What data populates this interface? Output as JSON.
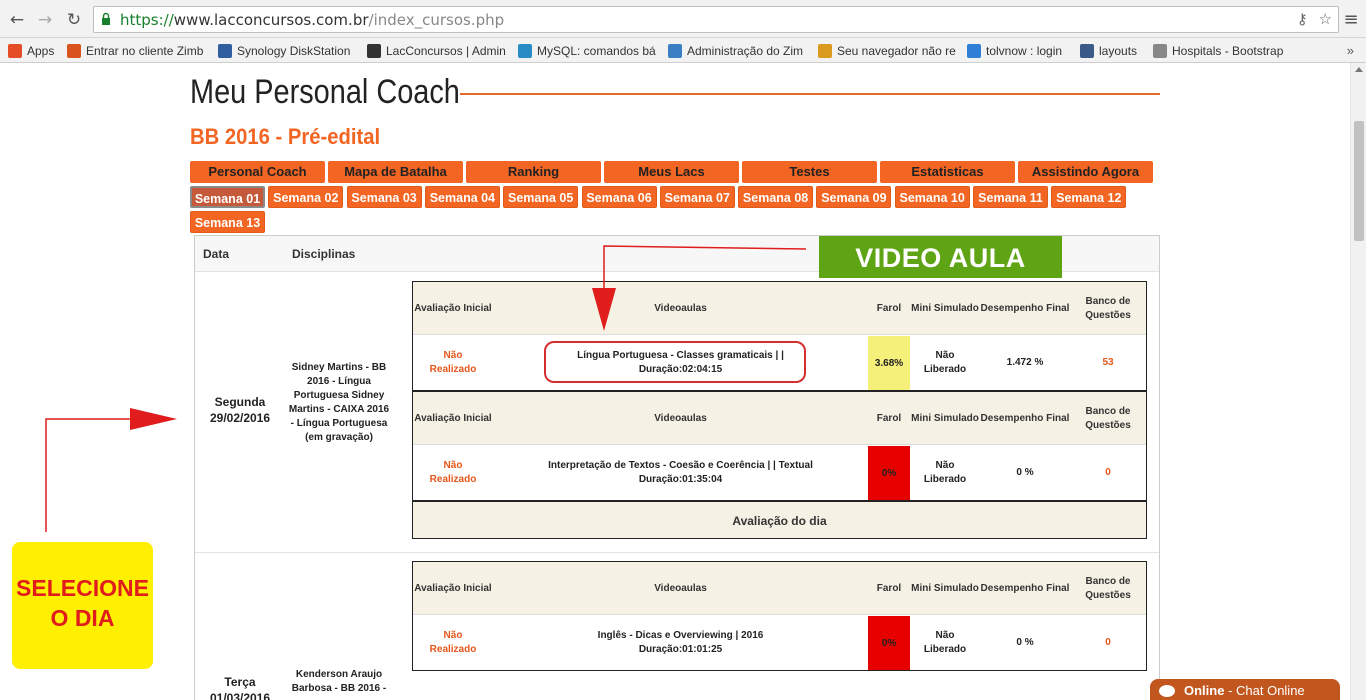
{
  "browser": {
    "url_scheme": "https://",
    "url_host": "www.lacconcursos.com.br",
    "url_path": "/index_cursos.php",
    "back_icon": "arrow-left-icon",
    "forward_icon": "arrow-right-icon",
    "reload_icon": "reload-icon",
    "key_icon": "key-icon",
    "star_icon": "star-icon",
    "bookmarks": [
      {
        "label": "Apps",
        "icon": "apps-grid-icon",
        "color": "#e44d26"
      },
      {
        "label": "Entrar no cliente Zimb",
        "icon": "zimbra-icon",
        "color": "#d9531e"
      },
      {
        "label": "Synology DiskStation",
        "icon": "dsm-icon",
        "color": "#2f5f9e"
      },
      {
        "label": "LacConcursos | Admin",
        "icon": "lac-icon",
        "color": "#333333"
      },
      {
        "label": "MySQL: comandos bá",
        "icon": "mysql-icon",
        "color": "#2a8cc4"
      },
      {
        "label": "Administração do Zim",
        "icon": "zimbra-z-icon",
        "color": "#3a7fc4"
      },
      {
        "label": "Seu navegador não re",
        "icon": "tt-icon",
        "color": "#d99a1e"
      },
      {
        "label": "tolvnow : login",
        "icon": "chat-bubble-icon",
        "color": "#2f7fd6"
      },
      {
        "label": "layouts",
        "icon": "w3-icon",
        "color": "#3b5a8a"
      },
      {
        "label": "Hospitals - Bootstrap",
        "icon": "page-icon",
        "color": "#888888"
      }
    ],
    "bookmarks_more": "»"
  },
  "page": {
    "title": "Meu Personal Coach",
    "course": "BB 2016 - Pré-edital",
    "tabs": [
      "Personal Coach",
      "Mapa de Batalha",
      "Ranking",
      "Meus Lacs",
      "Testes",
      "Estatisticas",
      "Assistindo Agora"
    ],
    "weeks": [
      "Semana 01",
      "Semana 02",
      "Semana 03",
      "Semana 04",
      "Semana 05",
      "Semana 06",
      "Semana 07",
      "Semana 08",
      "Semana 09",
      "Semana 10",
      "Semana 11",
      "Semana 12",
      "Semana 13"
    ],
    "active_week": "Semana 01",
    "table_headers": {
      "date": "Data",
      "disciplines": "Disciplinas"
    },
    "block_headers": [
      "Avaliação Inicial",
      "Videoaulas",
      "Farol",
      "Mini Simulado",
      "Desempenho Final",
      "Banco de Questões"
    ],
    "days": [
      {
        "day": "Segunda",
        "date": "29/02/2016",
        "disciplines": "Sidney Martins - BB 2016 - Língua Portuguesa Sidney Martins - CAIXA 2016 - Língua Portuguesa (em gravação)",
        "entries": [
          {
            "status": "Não Realizado",
            "video_title": "Língua Portuguesa - Classes gramaticais | |",
            "video_duration": "Duração:02:04:15",
            "farol": "3.68%",
            "farol_color": "#f4f07a",
            "mini": "Não Liberado",
            "final": "1.472 %",
            "bank": "53"
          },
          {
            "status": "Não Realizado",
            "video_title": "Interpretação de Textos - Coesão e Coerência | | Textual",
            "video_duration": "Duração:01:35:04",
            "farol": "0%",
            "farol_color": "#e60000",
            "mini": "Não Liberado",
            "final": "0 %",
            "bank": "0"
          }
        ],
        "evaluation": "Avaliação do dia"
      },
      {
        "day": "Terça",
        "date": "01/03/2016",
        "disciplines": "Kenderson Araujo Barbosa - BB 2016 -",
        "entries": [
          {
            "status": "Não Realizado",
            "video_title": "Inglês - Dicas e Overviewing | 2016",
            "video_duration": "Duração:01:01:25",
            "farol": "0%",
            "farol_color": "#e60000",
            "mini": "Não Liberado",
            "final": "0 %",
            "bank": "0"
          }
        ]
      }
    ]
  },
  "annotations": {
    "video_banner": "VIDEO AULA",
    "select_line1": "SELECIONE",
    "select_line2": "O DIA",
    "banner_color": "#5ea415",
    "select_color": "#ffef00",
    "arrow_color": "#e01c1c"
  },
  "chat": {
    "label": "Online",
    "suffix": " - Chat Online",
    "icon": "chat-bubble-icon"
  }
}
